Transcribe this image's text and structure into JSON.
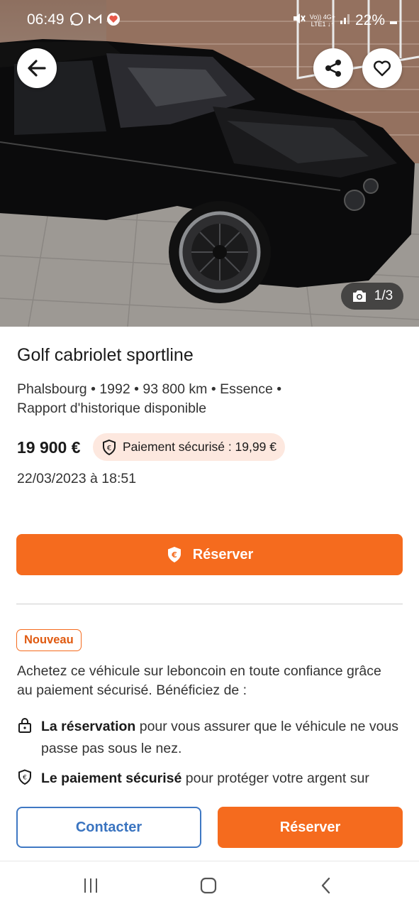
{
  "status_bar": {
    "time": "06:49",
    "left_icons": [
      "whatsapp-icon",
      "gmail-icon",
      "health-app-icon"
    ],
    "network_top": "Vo)) 4G+",
    "network_bottom": "LTE1 ↓↑",
    "battery": "22%"
  },
  "hero": {
    "photo_counter": "1/3"
  },
  "listing": {
    "title": "Golf cabriolet sportline",
    "subtitle": "Phalsbourg • 1992 • 93 800 km • Essence • Rapport d'historique disponible",
    "price": "19 900 €",
    "secure_payment": "Paiement sécurisé : 19,99 €",
    "date": "22/03/2023 à 18:51",
    "reserve_label": "Réserver"
  },
  "promo": {
    "badge": "Nouveau",
    "intro": "Achetez ce véhicule sur leboncoin en toute confiance grâce au paiement sécurisé. Bénéficiez de :",
    "benefits": [
      {
        "bold": "La réservation",
        "rest": " pour vous assurer que le véhicule ne vous passe pas sous le nez."
      },
      {
        "bold": "Le paiement sécurisé",
        "rest": " pour protéger votre argent sur"
      }
    ]
  },
  "bottom_bar": {
    "contact_label": "Contacter",
    "reserve_label": "Réserver"
  },
  "colors": {
    "accent": "#f56b1e",
    "link_blue": "#3a74c0",
    "pill_bg": "#fde8df"
  }
}
